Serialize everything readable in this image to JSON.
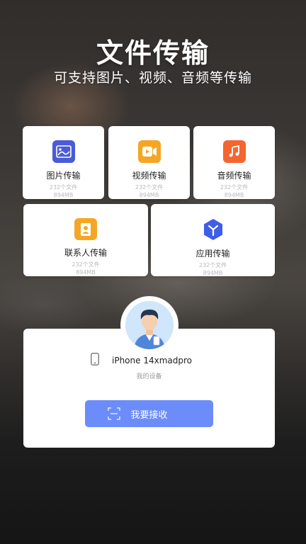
{
  "hero": {
    "title": "文件传输",
    "subtitle": "可支持图片、视频、音频等传输"
  },
  "categories": [
    {
      "label": "图片传输",
      "count": "232个文件",
      "size": "894MB",
      "icon": "image-icon",
      "color": "#4b5bd7"
    },
    {
      "label": "视频传输",
      "count": "232个文件",
      "size": "894MB",
      "icon": "video-icon",
      "color": "#f5a623"
    },
    {
      "label": "音频传输",
      "count": "232个文件",
      "size": "894MB",
      "icon": "music-icon",
      "color": "#f5652f"
    },
    {
      "label": "联系人传输",
      "count": "232个文件",
      "size": "894MB",
      "icon": "contact-icon",
      "color": "#f5a623"
    },
    {
      "label": "应用传输",
      "count": "232个文件",
      "size": "894MB",
      "icon": "app-icon",
      "color": "#3f5de8"
    }
  ],
  "device": {
    "name": "iPhone 14xmadpro",
    "subtitle": "我的设备"
  },
  "receive_button": {
    "label": "我要接收"
  },
  "colors": {
    "accent": "#6b8cf9",
    "card_bg": "#ffffff"
  }
}
